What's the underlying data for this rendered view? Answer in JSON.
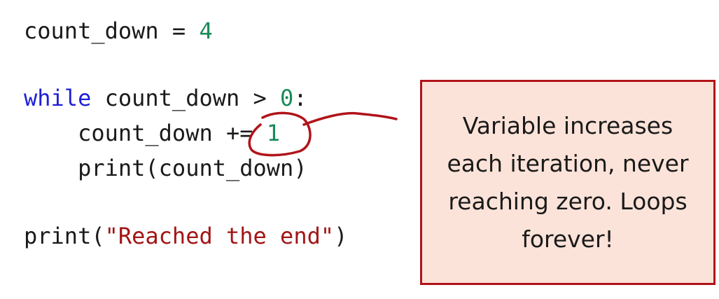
{
  "code": {
    "line1": {
      "var": "count_down",
      "op": " = ",
      "num": "4"
    },
    "line2": {
      "kw": "while",
      "rest": " count_down > ",
      "num": "0",
      "colon": ":"
    },
    "line3": {
      "indent": "    ",
      "var": "count_down ",
      "op": "+=",
      "space": " ",
      "num": "1"
    },
    "line4": {
      "text": "    print(count_down)"
    },
    "line5": {
      "pre": "print(",
      "str": "\"Reached the end\"",
      "post": ")"
    }
  },
  "callout": {
    "text": "Variable increases each iteration, never reaching zero. Loops forever!"
  },
  "colors": {
    "keyword": "#1f1fd6",
    "number": "#1a8a5a",
    "string": "#a31515",
    "annotation": "#b0141a",
    "callout_bg": "#fbe3d9"
  }
}
